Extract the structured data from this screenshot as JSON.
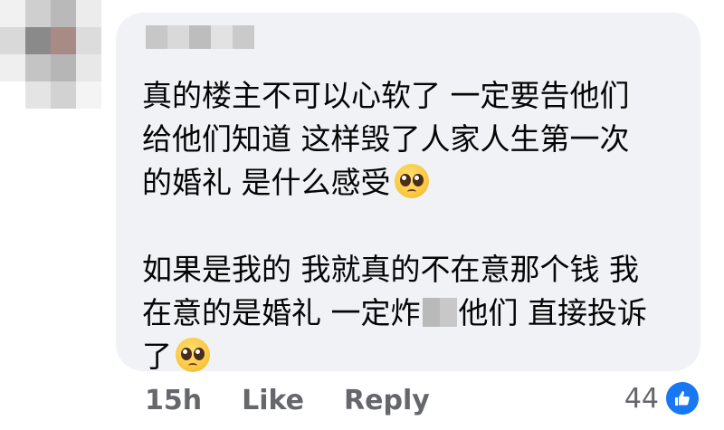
{
  "comment": {
    "lines": [
      "真的楼主不可以心软了 一定要告他们",
      "给他们知道 这样毁了人家人生第一次",
      "的婚礼 是什么感受"
    ],
    "lines2": [
      "如果是我的 我就真的不在意那个钱 我",
      "在意的是婚礼 一定炸",
      "他们 直接投诉",
      "了"
    ],
    "emoji": "pleading-face-emoji"
  },
  "footer": {
    "time": "15h",
    "like_label": "Like",
    "reply_label": "Reply"
  },
  "reactions": {
    "count": "44",
    "icon": "thumbs-up-icon",
    "color": "#1877f2"
  }
}
